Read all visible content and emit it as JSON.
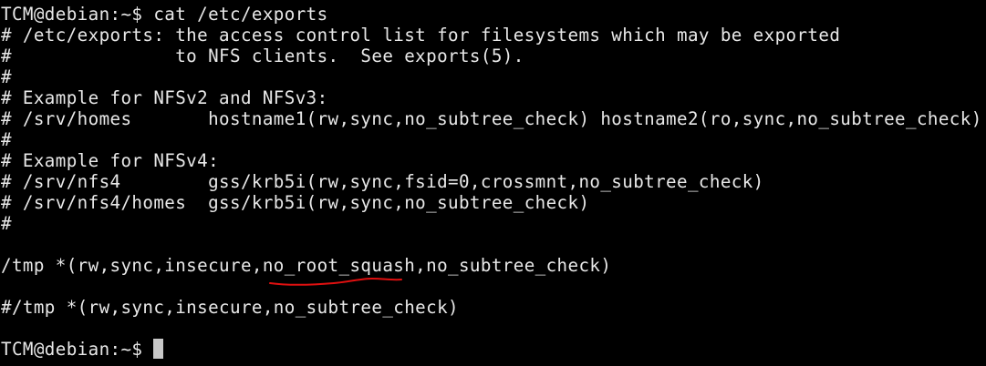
{
  "terminal": {
    "lines": [
      "TCM@debian:~$ cat /etc/exports",
      "# /etc/exports: the access control list for filesystems which may be exported",
      "#               to NFS clients.  See exports(5).",
      "#",
      "# Example for NFSv2 and NFSv3:",
      "# /srv/homes       hostname1(rw,sync,no_subtree_check) hostname2(ro,sync,no_subtree_check)",
      "#",
      "# Example for NFSv4:",
      "# /srv/nfs4        gss/krb5i(rw,sync,fsid=0,crossmnt,no_subtree_check)",
      "# /srv/nfs4/homes  gss/krb5i(rw,sync,no_subtree_check)",
      "#",
      "",
      "/tmp *(rw,sync,insecure,no_root_squash,no_subtree_check)",
      "",
      "#/tmp *(rw,sync,insecure,no_subtree_check)",
      "",
      "TCM@debian:~$ "
    ],
    "colors": {
      "background": "#000000",
      "text": "#e8e8e8",
      "cursor": "#c8c8c8",
      "annotation": "#e01010"
    }
  }
}
